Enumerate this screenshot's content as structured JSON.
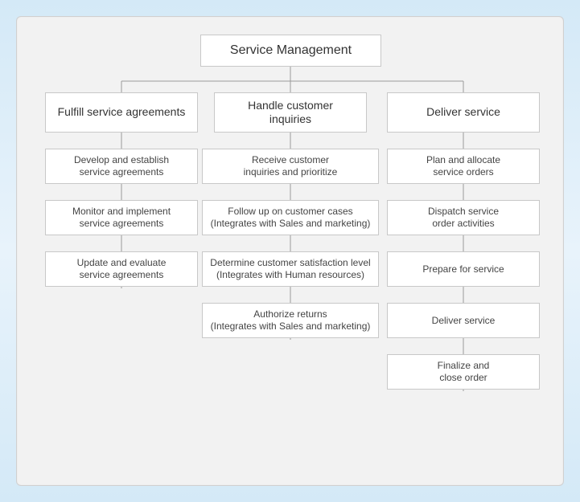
{
  "root": {
    "label": "Service Management"
  },
  "columns": [
    {
      "category": "Fulfill service agreements",
      "steps": [
        "Develop and establish\nservice agreements",
        "Monitor and implement\nservice agreements",
        "Update and evaluate\nservice agreements"
      ]
    },
    {
      "category": "Handle customer\ninquiries",
      "steps": [
        "Receive customer\ninquiries and prioritize",
        "Follow up on customer cases\n(Integrates with Sales and marketing)",
        "Determine customer satisfaction level\n(Integrates with Human resources)",
        "Authorize returns\n(Integrates with Sales and marketing)"
      ]
    },
    {
      "category": "Deliver service",
      "steps": [
        "Plan and allocate\nservice orders",
        "Dispatch service\norder activities",
        "Prepare for service",
        "Deliver service",
        "Finalize and\nclose order"
      ]
    }
  ]
}
